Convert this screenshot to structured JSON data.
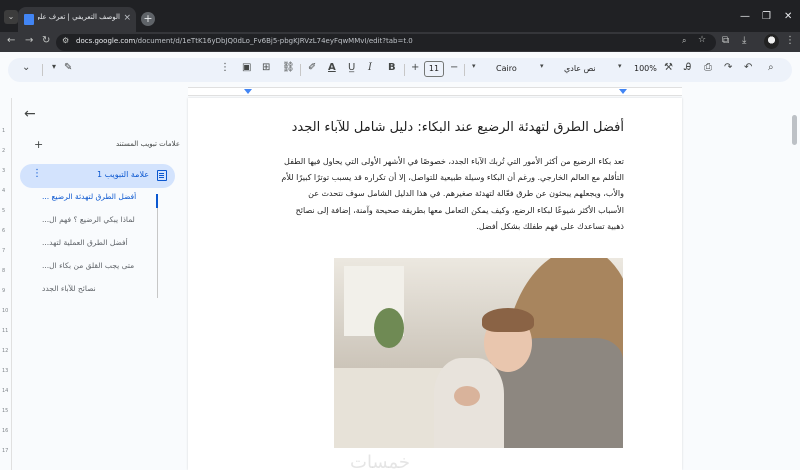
{
  "browser": {
    "tab_title": "الوصف التعريفي | تعرف على أن...",
    "url_host": "docs.google.com",
    "url_path": "/document/d/1eTtK16yDbJQ0dLo_Fv6Bj5-pbgKJRVzL74eyFqwMMvI/edit?tab=t.0",
    "icons": [
      "back-icon",
      "forward-icon",
      "reload-icon",
      "site-info-icon",
      "zoom-icon",
      "star-icon",
      "extensions-icon",
      "download-icon",
      "profile-avatar",
      "menu-icon"
    ]
  },
  "toolbar": {
    "zoom": "100%",
    "style": "نص عادي",
    "font": "Cairo",
    "font_size": "11",
    "bold": "B",
    "italic": "I",
    "underline": "A"
  },
  "outline": {
    "title": "علامات تبويب المستند",
    "tab_label": "علامة التبويب 1",
    "items": [
      "أفضل الطرق لتهدئة الرضيع ...",
      "لماذا يبكي الرضيع ؟ فهم ال...",
      "أفضل الطرق العملية لتهد...",
      "متى يجب القلق من بكاء ال...",
      "نصائح للآباء الجدد"
    ]
  },
  "document": {
    "title": "أفضل الطرق لتهدئة الرضيع عند البكاء: دليل شامل للآباء الجدد",
    "lines": [
      "تعد بكاء الرضيع من أكثر الأمور التي تُربك الآباء الجدد، خصوصًا في الأشهر الأولى التي يحاول فيها الطفل",
      "التأقلم مع العالم الخارجي. ورغم أن البكاء وسيلة طبيعية للتواصل، إلا أن تكراره قد يسبب توترًا كبيرًا للأم",
      "والأب، ويجعلهم يبحثون عن طرق فعّالة لتهدئة صغيرهم. في هذا الدليل الشامل سوف نتحدث عن",
      "الأسباب الأكثر شيوعًا لبكاء الرضع، وكيف يمكن التعامل معها بطريقة صحيحة وآمنة، إضافة إلى نصائح",
      "ذهبية تساعدك على فهم طفلك بشكل أفضل."
    ]
  },
  "watermark": "خمسات"
}
